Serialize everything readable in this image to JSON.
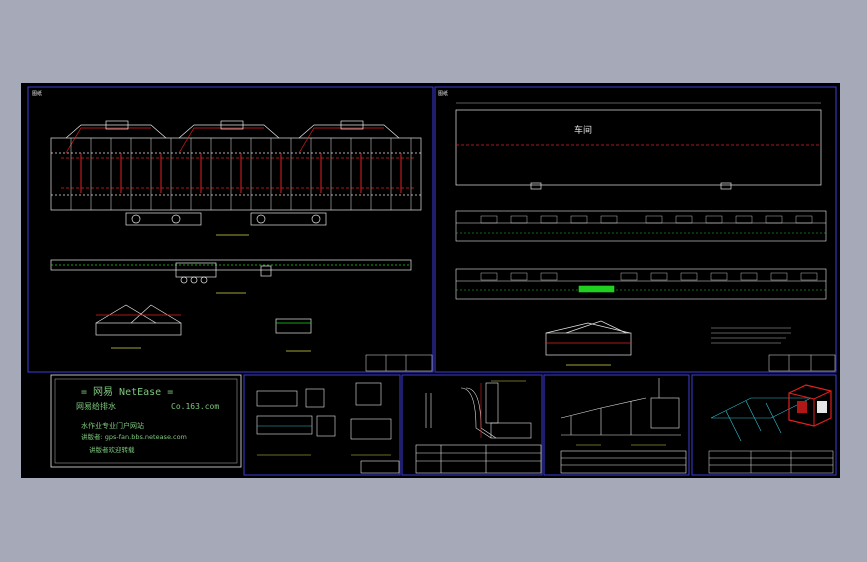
{
  "window": {
    "background_color": "#a6a9b7",
    "canvas_color": "#000000",
    "frame_color": "#3b3bd9",
    "line_color_main": "#e6e6e6",
    "line_color_red": "#e02020",
    "line_color_green": "#20d020",
    "line_color_cyan": "#30c0d0"
  },
  "sheet_1": {
    "corner_label": "图纸"
  },
  "sheet_2": {
    "corner_label": "图纸",
    "workshop_label": "车间"
  },
  "logo_block": {
    "line1": "= 网易 NetEase =",
    "line2_left": "网易给排水",
    "line2_right": "Co.163.com",
    "line3": "水作业专业门户网站",
    "line4": "讲版者: gps-fan.bbs.netease.com",
    "line5": "讲版者欢迎转载"
  },
  "icons": {
    "isometric_box": "iso-box-icon"
  }
}
